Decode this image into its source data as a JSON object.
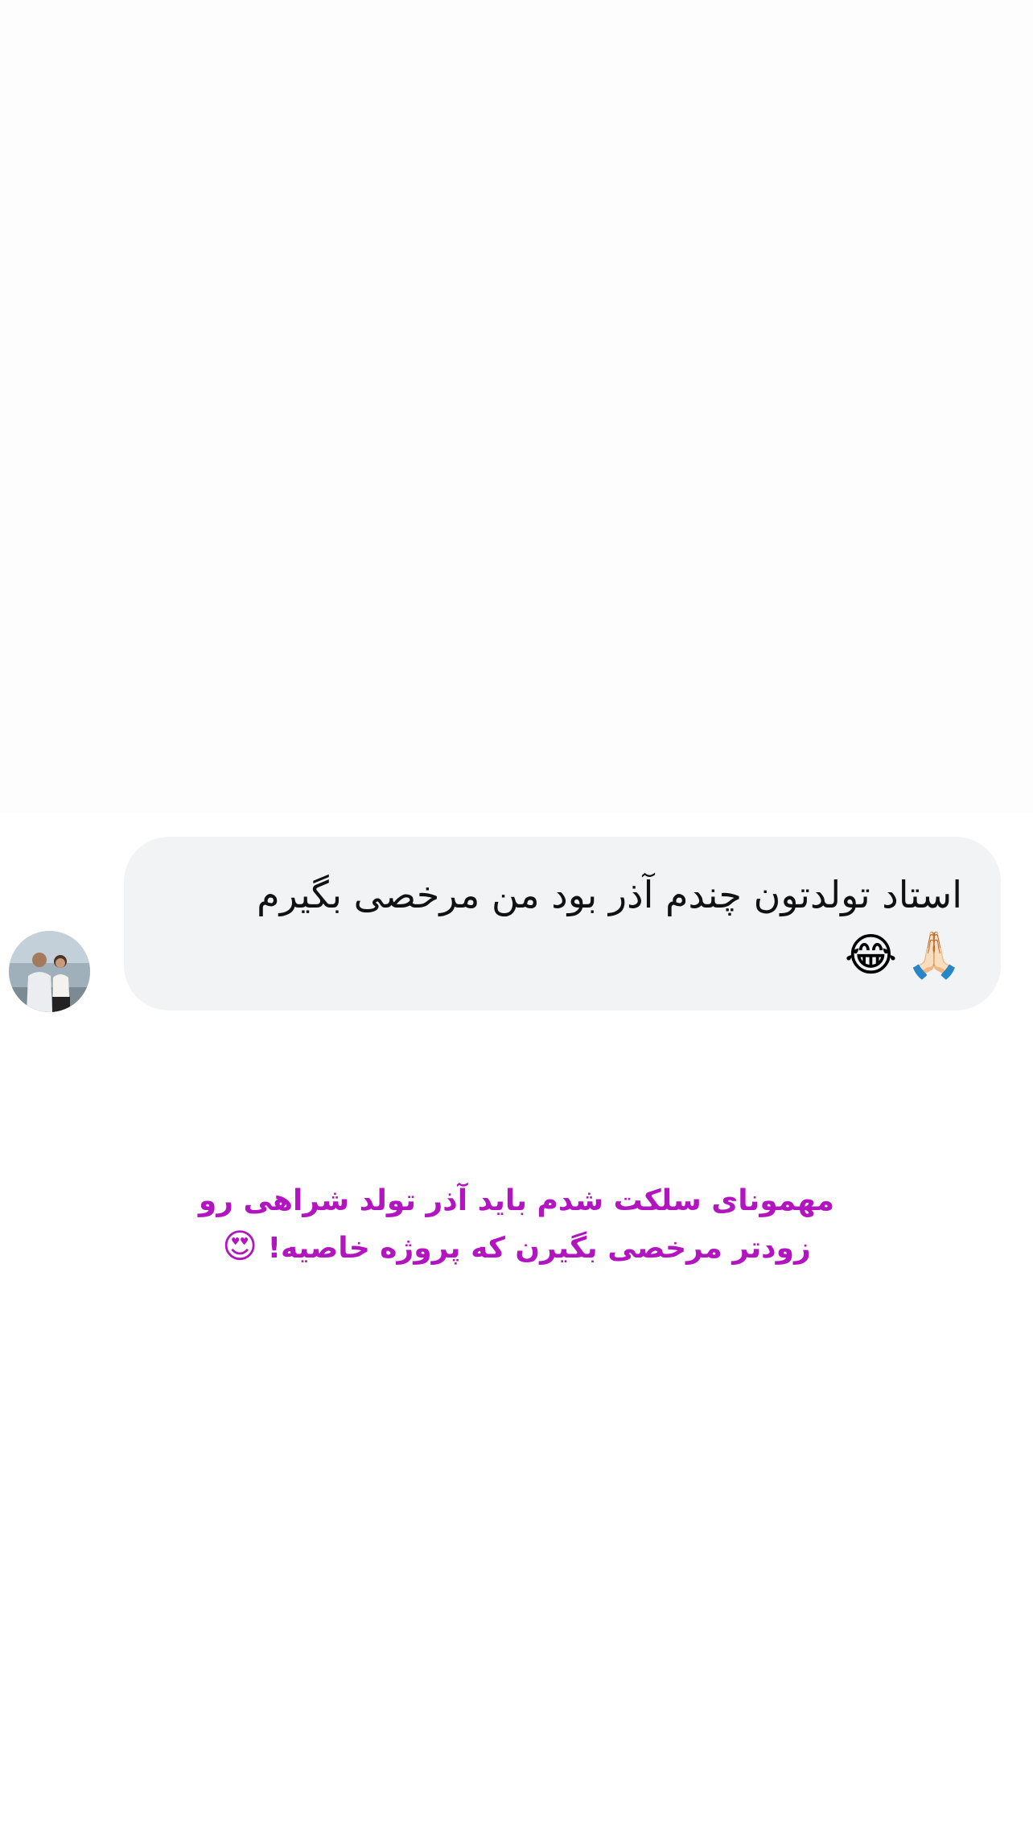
{
  "message": {
    "text": "استاد تولدتون چندم آذر بود من مرخصی بگیرم",
    "emoji_1": "🙏🏻",
    "emoji_2": "😂"
  },
  "caption": {
    "line_1": "مهمونای سلکت شدم باید آذر تولد شراهی رو",
    "line_2": "زودتر مرخصی بگیرن که پروژه خاصیه!",
    "emoji": "😍"
  },
  "colors": {
    "bubble_background": "#f2f3f5",
    "message_text": "#111111",
    "caption_text": "#b214bf",
    "page_background": "#ffffff"
  },
  "icons": {
    "avatar": "profile-photo-two-people"
  }
}
